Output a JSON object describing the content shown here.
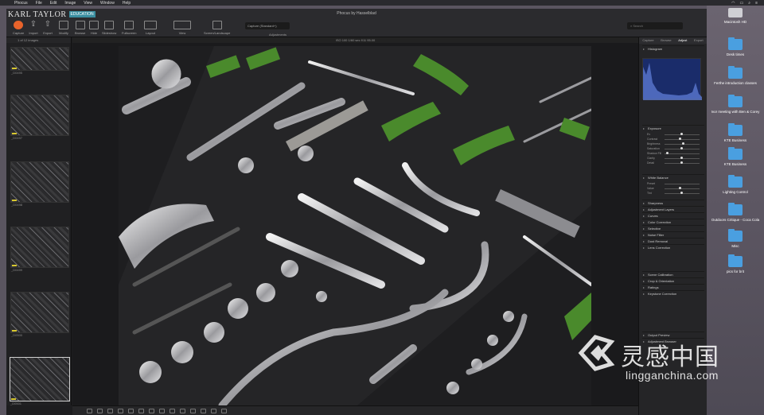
{
  "menubar": {
    "app": "Phocus",
    "items": [
      "File",
      "Edit",
      "Image",
      "View",
      "Window",
      "Help"
    ]
  },
  "brand": {
    "name": "KARL TAYLOR",
    "edu": "EDUCATION"
  },
  "window": {
    "title": "Phocus by Hasselblad"
  },
  "toolbar": {
    "buttons": [
      {
        "label": "Capture"
      },
      {
        "label": "Import"
      },
      {
        "label": "Export"
      },
      {
        "label": "Modify"
      },
      {
        "label": "Browse"
      },
      {
        "label": "Hide"
      },
      {
        "label": "Slideshow"
      },
      {
        "label": "Fullscreen"
      },
      {
        "label": "Layout"
      },
      {
        "label": "View"
      },
      {
        "label": "Screen/Landscape"
      }
    ],
    "style_value": "Capture (Standard+)",
    "adjustments_label": "Adjustments",
    "search_label": "Search"
  },
  "browser": {
    "header": "1 of 12 images",
    "thumbs": [
      "_D0495",
      "_D0497",
      "_D0498",
      "_D0499",
      "_D0500",
      "_D0501"
    ]
  },
  "viewer": {
    "header": "ISO 100  1/60 sec  f/11  95.00"
  },
  "inspector": {
    "tabs": [
      "Capture",
      "Browse",
      "Adjust",
      "Export"
    ],
    "active_tab": "Adjust",
    "sections": [
      "Histogram",
      "Exposure",
      "White Balance",
      "Sharpness",
      "Adjustment Layers",
      "Curves",
      "Color Correction",
      "Selective",
      "Noise Filter",
      "Dust Removal",
      "Lens Correction",
      "Scene Calibration",
      "Crop & Orientation",
      "Ratings",
      "Keystone Correction",
      "Output Preview",
      "Adjustment Browser"
    ],
    "exposure_sliders": [
      "Ev",
      "Contrast",
      "Brightness",
      "Saturation",
      "Shadow Fill",
      "Clarity",
      "Detail"
    ],
    "wb_sliders": [
      "Preset",
      "Value",
      "Tint"
    ]
  },
  "desktop": {
    "items": [
      "Macintosh HD",
      "Desk times",
      "Ferthe introduction classes",
      "Ivor meeting with Ben & Corey",
      "KTE Business",
      "KTE Business",
      "Lighting Control",
      "Outdoors Critique - Coca Cola",
      "Misc",
      "pics for brit"
    ]
  },
  "watermark": {
    "cn": "灵感中国",
    "url": "lingganchina.com"
  }
}
